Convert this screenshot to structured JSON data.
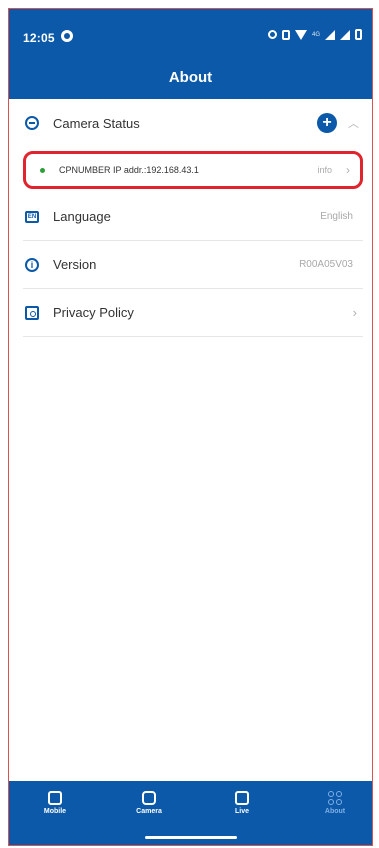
{
  "status_bar": {
    "time": "12:05",
    "network": "4G"
  },
  "header": {
    "title": "About"
  },
  "sections": {
    "camera_status": {
      "label": "Camera Status"
    },
    "camera": {
      "text": "CPNUMBER IP addr.:192.168.43.1",
      "info": "info"
    },
    "language": {
      "label": "Language",
      "value": "English"
    },
    "version": {
      "label": "Version",
      "value": "R00A05V03"
    },
    "privacy": {
      "label": "Privacy Policy"
    }
  },
  "nav": [
    {
      "label": "Mobile"
    },
    {
      "label": "Camera"
    },
    {
      "label": "Live"
    },
    {
      "label": "About"
    }
  ],
  "colors": {
    "brand": "#0b59a8",
    "highlight": "#e0242e",
    "online": "#2e9e3a"
  }
}
